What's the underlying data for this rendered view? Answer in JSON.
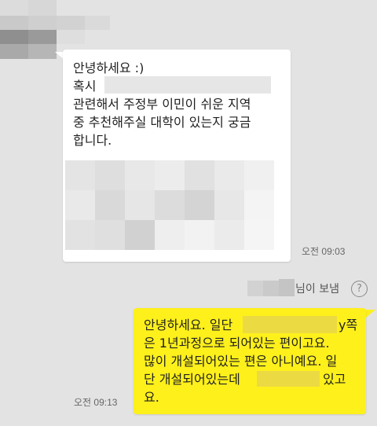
{
  "incoming": {
    "line1": "안녕하세요 :)",
    "line2": "혹시 ",
    "line3": "관련해서 주정부 이민이 쉬운 지역",
    "line4": "중 추천해주실 대학이 있는지 궁금",
    "line5": "합니다.",
    "time": "오전 09:03"
  },
  "sent_by": {
    "label": "님이 보냄",
    "help_glyph": "?"
  },
  "outgoing": {
    "line1a": "안녕하세요. 일단",
    "line1b": "y쪽",
    "line2": "은 1년과정으로 되어있는 편이고요.",
    "line3": "많이 개설되어있는 편은 아니예요. 일",
    "line4a": "단 개설되어있는데",
    "line4b": "있고",
    "line5": "요.",
    "time": "오전 09:13"
  },
  "colors": {
    "background": "#e3e3e3",
    "incoming_bubble": "#ffffff",
    "outgoing_bubble": "#fef01b"
  }
}
